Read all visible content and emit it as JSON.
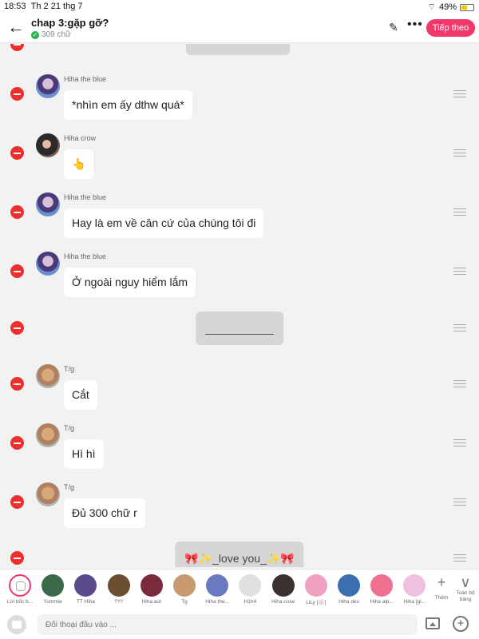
{
  "status": {
    "time": "18:53",
    "date": "Th 2 21 thg 7",
    "battery": "49%",
    "battery_level": 0.49
  },
  "header": {
    "back_icon": "←",
    "title": "chap 3:gặp gỡ?",
    "word_count": "309 chữ",
    "edit_icon": "✎",
    "more_icon": "•••",
    "next_button": "Tiếp theo"
  },
  "messages": [
    {
      "type": "char",
      "sender": "Hiha the blue",
      "avatar": "blue",
      "text": "*nhìn em ấy dthw quá*"
    },
    {
      "type": "char",
      "sender": "Hiha crow",
      "avatar": "crow",
      "text": "👆"
    },
    {
      "type": "char",
      "sender": "Hiha the blue",
      "avatar": "blue",
      "text": "Hay là em về căn cứ của chúng tôi đi"
    },
    {
      "type": "char",
      "sender": "Hiha the blue",
      "avatar": "blue",
      "text": "Ở ngoài nguy hiểm lắm"
    },
    {
      "type": "narration",
      "text": "___________"
    },
    {
      "type": "char",
      "sender": "T/g",
      "avatar": "tg",
      "text": "Cắt"
    },
    {
      "type": "char",
      "sender": "T/g",
      "avatar": "tg",
      "text": "Hì hì"
    },
    {
      "type": "char",
      "sender": "T/g",
      "avatar": "tg",
      "text": "Đủ 300 chữ r"
    },
    {
      "type": "narration",
      "text": "🎀✨_love you_✨🎀"
    }
  ],
  "characters": [
    {
      "label": "Lời bốc b...",
      "color": "narrator"
    },
    {
      "label": "Yummie",
      "color": "#3a6a4a"
    },
    {
      "label": "TT Hiha",
      "color": "#5a4a8a"
    },
    {
      "label": "???",
      "color": "#6a5030"
    },
    {
      "label": "Hiha aut",
      "color": "#7a2a3a"
    },
    {
      "label": "Tg",
      "color": "#c89a70"
    },
    {
      "label": "Hiha the...",
      "color": "#6a7ac0"
    },
    {
      "label": "H1h4",
      "color": "#e0e0e0"
    },
    {
      "label": "Hiha crow",
      "color": "#3a3030"
    },
    {
      "label": "LiLy [🍥]",
      "color": "#f0a0c0"
    },
    {
      "label": "Hiha des",
      "color": "#3a70b0"
    },
    {
      "label": "Hiha alp...",
      "color": "#f07090"
    },
    {
      "label": "Hiha [gi...",
      "color": "#f0c0e0"
    }
  ],
  "char_bar": {
    "add_label": "Thêm",
    "all_label": "Toàn bộ bảng",
    "add_icon": "+",
    "all_icon": "∨"
  },
  "input": {
    "placeholder": "Đối thoại đầu vào ..."
  }
}
